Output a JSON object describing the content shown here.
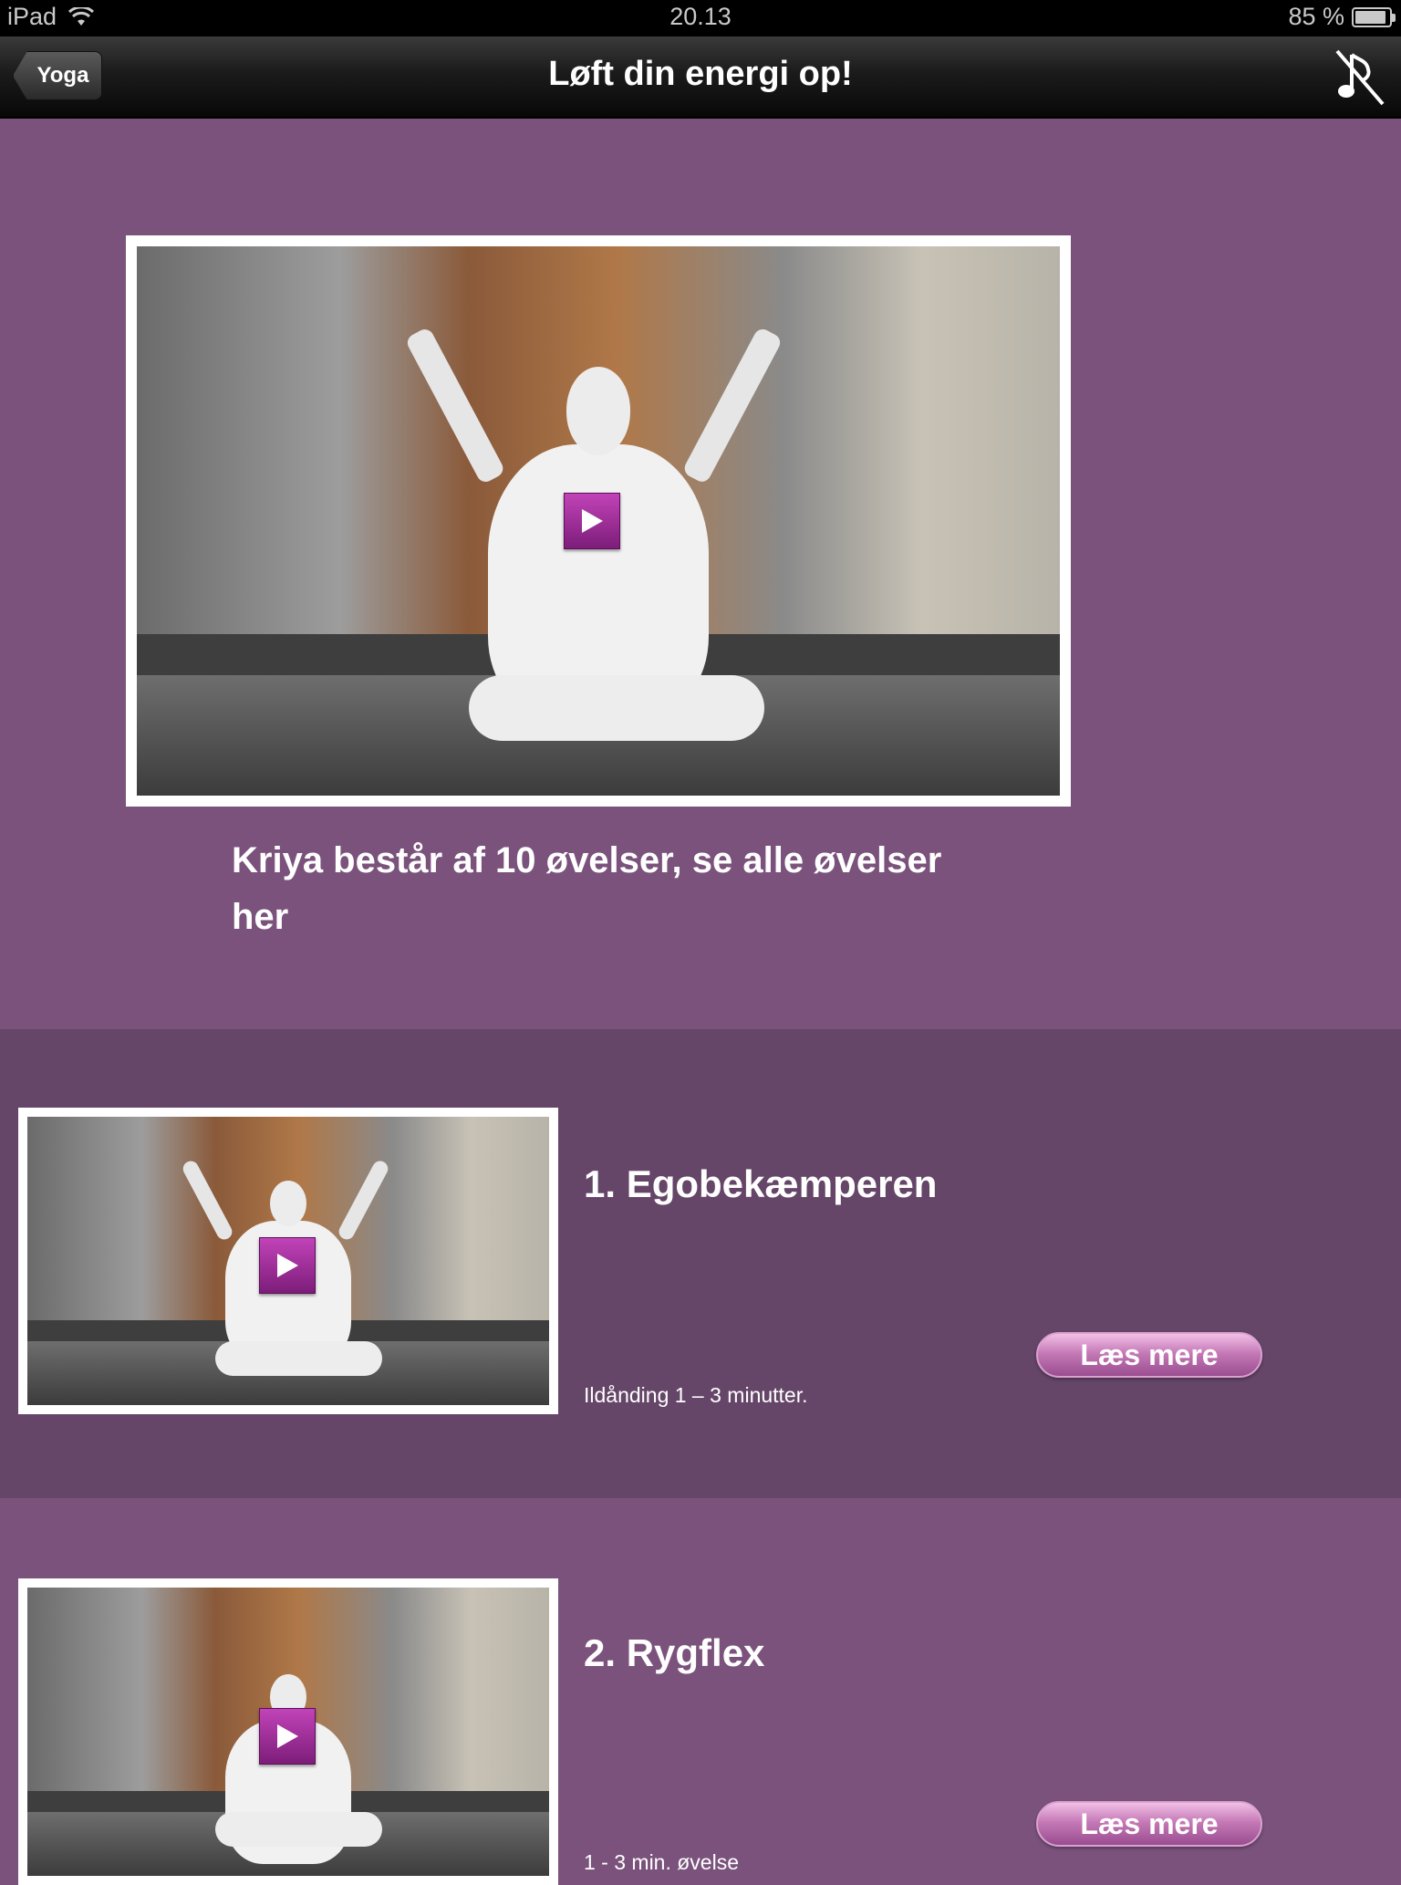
{
  "status_bar": {
    "device": "iPad",
    "time": "20.13",
    "battery": "85 %",
    "battery_level": 0.85
  },
  "nav": {
    "back_label": "Yoga",
    "title": "Løft din energi op!",
    "music_toggle_icon": "music-off-icon"
  },
  "hero": {
    "caption": "Kriya består af 10 øvelser, se alle øvelser her",
    "play_icon": "play-icon"
  },
  "exercises": [
    {
      "title": "1. Egobekæmperen",
      "description": "Ildånding 1 – 3 minutter.",
      "button_label": "Læs mere"
    },
    {
      "title": "2. Rygflex",
      "description": "1 - 3 min. øvelse",
      "button_label": "Læs mere"
    }
  ],
  "colors": {
    "background": "#7a527c",
    "row_dark": "#654568",
    "accent": "#a33a9c"
  }
}
